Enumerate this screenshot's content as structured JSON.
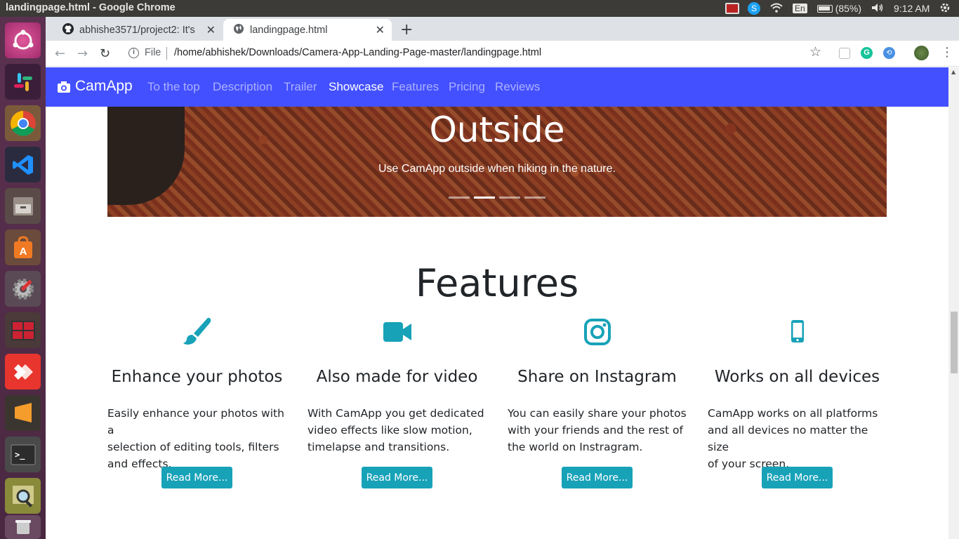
{
  "window": {
    "title": "landingpage.html - Google Chrome"
  },
  "tray": {
    "keyboard": "En",
    "battery": "(85%)",
    "clock": "9:12 AM"
  },
  "launcher": {
    "items": [
      "ubuntu-icon",
      "slack-icon",
      "chrome-icon",
      "vscode-icon",
      "files-icon",
      "software-center-icon",
      "settings-icon",
      "workspace-icon",
      "anydesk-icon",
      "sublime-icon",
      "terminal-icon",
      "image-viewer-icon",
      "trash-icon"
    ]
  },
  "tabs": [
    {
      "label": "abhishe3571/project2: It's",
      "icon": "github-icon"
    },
    {
      "label": "landingpage.html",
      "icon": "globe-icon"
    }
  ],
  "address": {
    "scheme_label": "File",
    "url": "/home/abhishek/Downloads/Camera-App-Landing-Page-master/landingpage.html"
  },
  "site": {
    "brand": "CamApp",
    "nav": [
      "To the top",
      "Description",
      "Trailer",
      "Showcase",
      "Features",
      "Pricing",
      "Reviews"
    ],
    "active_nav": "Showcase",
    "accent": "#4350ff"
  },
  "carousel": {
    "title": "Outside",
    "caption": "Use CamApp outside when hiking in the nature.",
    "slides": 4,
    "active": 2
  },
  "features": {
    "title": "Features",
    "items": [
      {
        "icon": "paint-brush-icon",
        "heading": "Enhance your photos",
        "lines": [
          "Easily enhance your photos with a",
          "selection of editing tools, filters",
          "and effects."
        ],
        "button": "Read More..."
      },
      {
        "icon": "video-camera-icon",
        "heading": "Also made for video",
        "lines": [
          "With CamApp you get dedicated",
          "video effects like slow motion,",
          "timelapse and transitions."
        ],
        "button": "Read More..."
      },
      {
        "icon": "instagram-icon",
        "heading": "Share on Instagram",
        "lines": [
          "You can easily share your photos",
          "with your friends and the rest of",
          "the world on Instragram."
        ],
        "button": "Read More..."
      },
      {
        "icon": "mobile-phone-icon",
        "heading": "Works on all devices",
        "lines": [
          "CamApp works on all platforms",
          "and all devices no matter the size",
          "of your screen."
        ],
        "button": "Read More..."
      }
    ],
    "icon_color": "#17a2b8"
  }
}
